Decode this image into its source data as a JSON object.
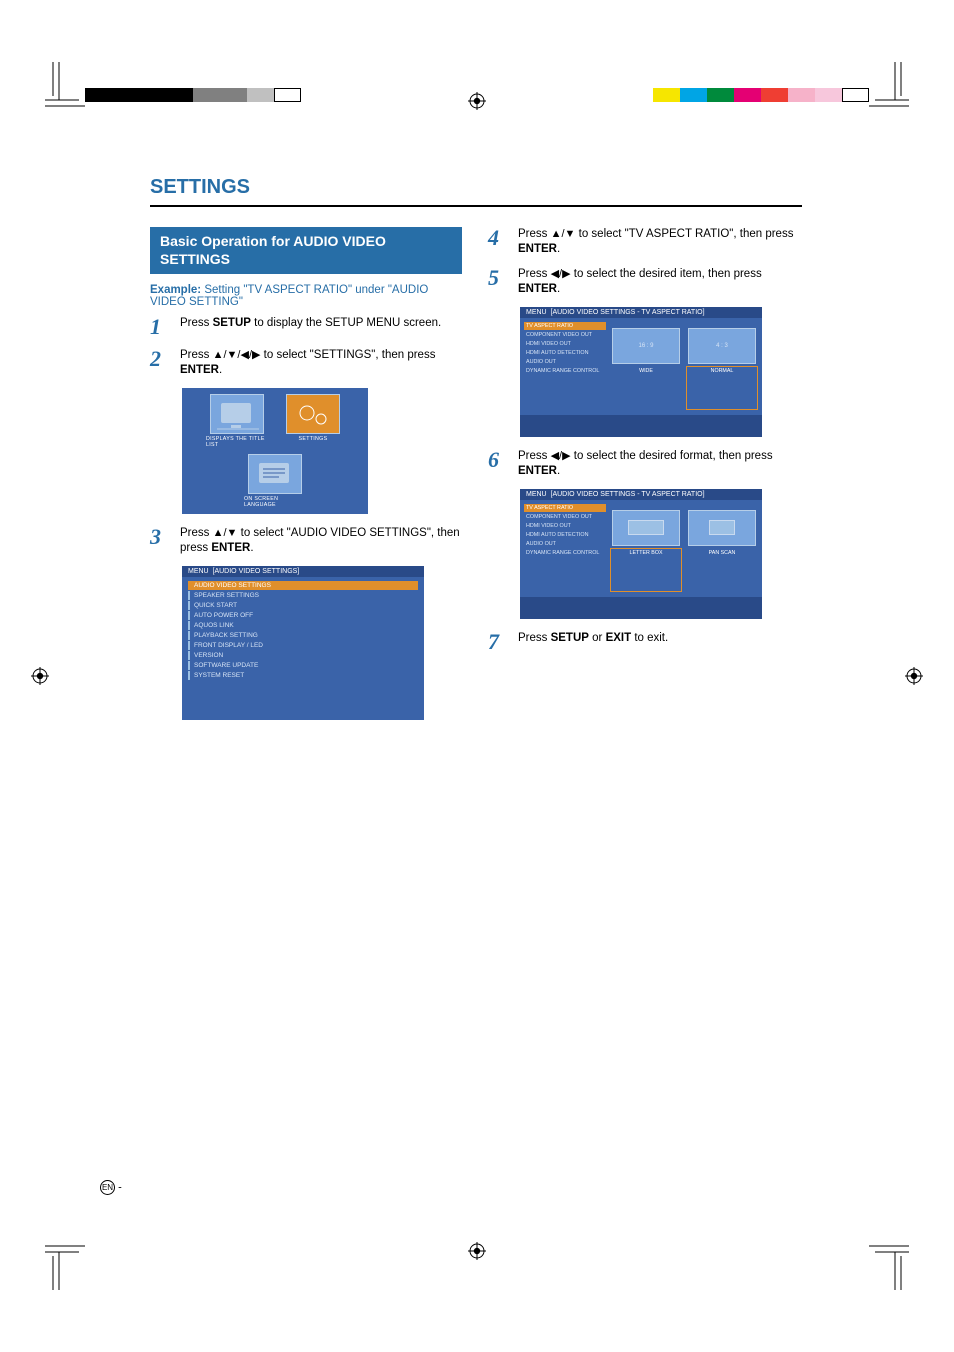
{
  "section_title": "SETTINGS",
  "subheader": "Basic Operation for AUDIO VIDEO SETTINGS",
  "example_label": "Example:",
  "example_text": " Setting \"TV ASPECT RATIO\" under \"AUDIO VIDEO SETTING\"",
  "steps": {
    "1": {
      "pre": "Press ",
      "key": "SETUP",
      "post": " to display the SETUP MENU screen."
    },
    "2": {
      "pre": "Press ",
      "arrows": "▲/▼/◀/▶",
      "mid": " to select \"SETTINGS\", then press ",
      "key": "ENTER",
      "post": "."
    },
    "3": {
      "pre": "Press ",
      "arrows": "▲/▼",
      "mid": " to select \"AUDIO VIDEO SETTINGS\", then press ",
      "key": "ENTER",
      "post": "."
    },
    "4": {
      "pre": "Press ",
      "arrows": "▲/▼",
      "mid": " to select \"TV ASPECT RATIO\", then press ",
      "key": "ENTER",
      "post": "."
    },
    "5": {
      "pre": "Press ",
      "arrows": "◀/▶",
      "mid": " to select the desired item, then press ",
      "key": "ENTER",
      "post": "."
    },
    "6": {
      "pre": "Press ",
      "arrows": "◀/▶",
      "mid": " to select the desired format, then press ",
      "key": "ENTER",
      "post": "."
    },
    "7": {
      "pre": "Press ",
      "key": "SETUP",
      "mid": " or ",
      "key2": "EXIT",
      "post": " to exit."
    }
  },
  "osd_tiles": {
    "t1": "DISPLAYS THE TITLE LIST",
    "t2": "SETTINGS",
    "t3": "ON SCREEN LANGUAGE"
  },
  "osd_list": {
    "header_prefix": "MENU",
    "header": "[AUDIO VIDEO SETTINGS]",
    "items": [
      "AUDIO VIDEO SETTINGS",
      "SPEAKER SETTINGS",
      "QUICK START",
      "AUTO POWER OFF",
      "AQUOS LINK",
      "PLAYBACK SETTING",
      "FRONT DISPLAY / LED",
      "VERSION",
      "SOFTWARE UPDATE",
      "SYSTEM RESET"
    ],
    "selected_index": 0
  },
  "osd_ratio_a": {
    "header_prefix": "MENU",
    "header": "[AUDIO VIDEO SETTINGS  -  TV ASPECT RATIO]",
    "left_items": [
      "TV ASPECT RATIO",
      "COMPONENT VIDEO OUT",
      "HDMI VIDEO OUT",
      "HDMI AUTO DETECTION",
      "AUDIO OUT",
      "DYNAMIC RANGE CONTROL"
    ],
    "selected_index": 0,
    "options": [
      "16 : 9",
      "4 : 3"
    ],
    "labels": [
      "WIDE",
      "NORMAL"
    ],
    "selected_label_index": 1
  },
  "osd_ratio_b": {
    "header_prefix": "MENU",
    "header": "[AUDIO VIDEO SETTINGS  -  TV ASPECT RATIO]",
    "left_items": [
      "TV ASPECT RATIO",
      "COMPONENT VIDEO OUT",
      "HDMI VIDEO OUT",
      "HDMI AUTO DETECTION",
      "AUDIO OUT",
      "DYNAMIC RANGE CONTROL"
    ],
    "selected_index": 0,
    "labels": [
      "LETTER BOX",
      "PAN SCAN"
    ],
    "selected_label_index": 0
  },
  "page_footer": {
    "lang": "EN",
    "dash": "-"
  },
  "swatch_colors_left": [
    "#000",
    "#000",
    "#000",
    "#000",
    "#808080",
    "#808080",
    "#C0C0C0",
    "#fff"
  ],
  "swatch_colors_right": [
    "#F6E600",
    "#00A5E5",
    "#008A3C",
    "#E40073",
    "#EF3E33",
    "#F6B2C9",
    "#F7C7DC",
    "#fff"
  ]
}
